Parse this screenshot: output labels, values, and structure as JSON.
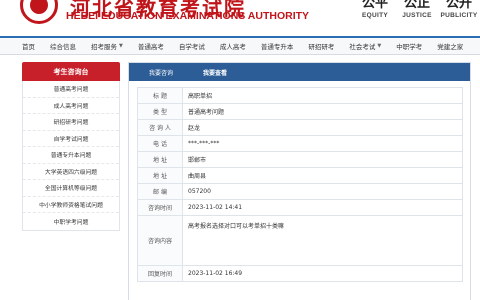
{
  "header": {
    "site_title_cn": "河北省教育考试院",
    "site_title_en": "HEBEI EDUCATION EXAMINATIONS AUTHORITY",
    "slogans": [
      {
        "cn": "公平",
        "en": "EQUITY"
      },
      {
        "cn": "公正",
        "en": "JUSTICE"
      },
      {
        "cn": "公开",
        "en": "PUBLICITY"
      }
    ]
  },
  "nav": {
    "items": [
      {
        "label": "首页",
        "has_dropdown": false
      },
      {
        "label": "综合信息",
        "has_dropdown": false
      },
      {
        "label": "招考服务",
        "has_dropdown": true
      },
      {
        "label": "普通高考",
        "has_dropdown": false
      },
      {
        "label": "自学考试",
        "has_dropdown": false
      },
      {
        "label": "成人高考",
        "has_dropdown": false
      },
      {
        "label": "普通专升本",
        "has_dropdown": false
      },
      {
        "label": "研招研考",
        "has_dropdown": false
      },
      {
        "label": "社会考试",
        "has_dropdown": true
      },
      {
        "label": "中职学考",
        "has_dropdown": false
      },
      {
        "label": "党建之家",
        "has_dropdown": false
      }
    ]
  },
  "sidebar": {
    "title": "考生咨询台",
    "items": [
      "普通高考问题",
      "成人高考问题",
      "研招研考问题",
      "自学考试问题",
      "普通专升本问题",
      "大学英语四六级问题",
      "全国计算机等级问题",
      "中小学教师资格笔试问题",
      "中职学考问题"
    ]
  },
  "tabs": {
    "consult": "我要咨询",
    "query": "我要查看"
  },
  "detail": {
    "rows": [
      {
        "label": "标 题",
        "value": "高职单招"
      },
      {
        "label": "类 型",
        "value": "普通高考问题"
      },
      {
        "label": "咨 询 人",
        "value": "赵龙"
      },
      {
        "label": "电 话",
        "value": "***-***-***"
      },
      {
        "label": "地 址",
        "value": "邯郸市"
      },
      {
        "label": "地 址",
        "value": "曲周县"
      },
      {
        "label": "邮 编",
        "value": "057200"
      },
      {
        "label": "咨询时间",
        "value": "2023-11-02 14:41"
      }
    ],
    "content_label": "咨询内容",
    "content_value": "高考报名选择对口可以考单招十类嘛",
    "reply_time_label": "回复时间",
    "reply_time_value": "2023-11-02 16:49"
  }
}
